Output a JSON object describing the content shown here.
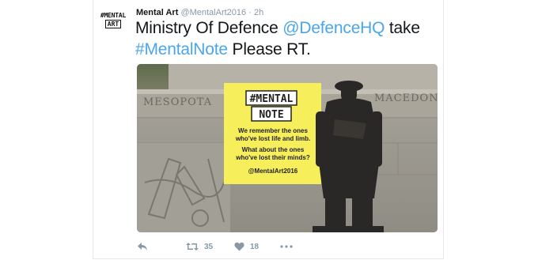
{
  "tweet": {
    "avatar": {
      "line1": "#MENTAL",
      "line2": "ART"
    },
    "author_name": "Mental Art",
    "author_handle": "@MentalArt2016",
    "separator": "·",
    "timestamp": "2h",
    "text_parts": {
      "t1": "Ministry Of Defence ",
      "mention": "@DefenceHQ",
      "t2": " take",
      "hashtag": "#MentalNote",
      "t3": " Please RT."
    },
    "media": {
      "poster": {
        "title_line1": "#MENTAL",
        "title_line2": "NOTE",
        "body_line1": "We remember the ones",
        "body_line2": "who've lost life and limb.",
        "body_line3": "What about the ones",
        "body_line4": "who've lost their minds?",
        "handle": "@MentalArt2016"
      },
      "inscription_left": "MESOPOTA",
      "inscription_right": "MACEDONI"
    },
    "actions": {
      "reply_icon": "reply-icon",
      "retweet_icon": "retweet-icon",
      "retweet_count": "35",
      "like_icon": "heart-icon",
      "like_count": "18",
      "more_icon": "more-dots-icon"
    }
  },
  "colors": {
    "link": "#4aa6e9",
    "muted": "#8899a6",
    "text": "#14171a",
    "poster": "#f7ee5c"
  }
}
